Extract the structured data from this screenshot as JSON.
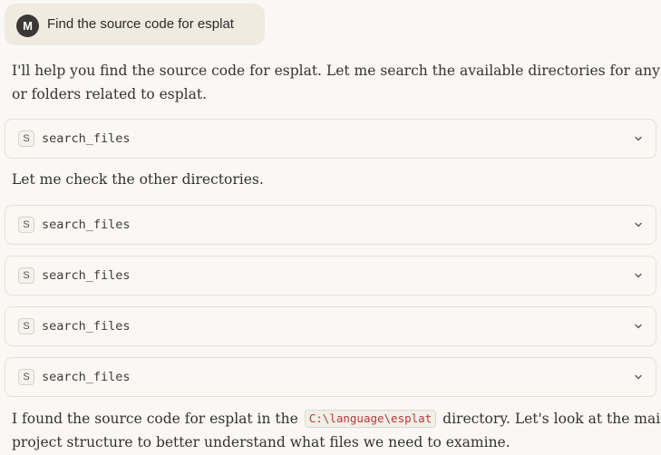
{
  "user_message": {
    "avatar_initial": "M",
    "text": "Find the source code for esplat"
  },
  "assistant": {
    "intro_line1": "I'll help you find the source code for esplat. Let me search the available directories for any files",
    "intro_line2": "or folders related to esplat.",
    "check_text": "Let me check the other directories.",
    "final_pre": "I found the source code for esplat in the",
    "final_code": "C:\\language\\esplat",
    "final_post": "directory. Let's look at the main",
    "final_line2": "project structure to better understand what files we need to examine."
  },
  "tool_calls": [
    {
      "icon_label": "S",
      "name": "search_files",
      "icon": "chevron-down-icon"
    },
    {
      "icon_label": "S",
      "name": "search_files",
      "icon": "chevron-down-icon"
    },
    {
      "icon_label": "S",
      "name": "search_files",
      "icon": "chevron-down-icon"
    },
    {
      "icon_label": "S",
      "name": "search_files",
      "icon": "chevron-down-icon"
    },
    {
      "icon_label": "S",
      "name": "search_files",
      "icon": "chevron-down-icon"
    }
  ],
  "colors": {
    "background": "#f9f8f4",
    "user_bubble": "#efebe1",
    "avatar": "#3a3935",
    "code_text": "#b83a3a",
    "border": "#e4e1d8"
  }
}
